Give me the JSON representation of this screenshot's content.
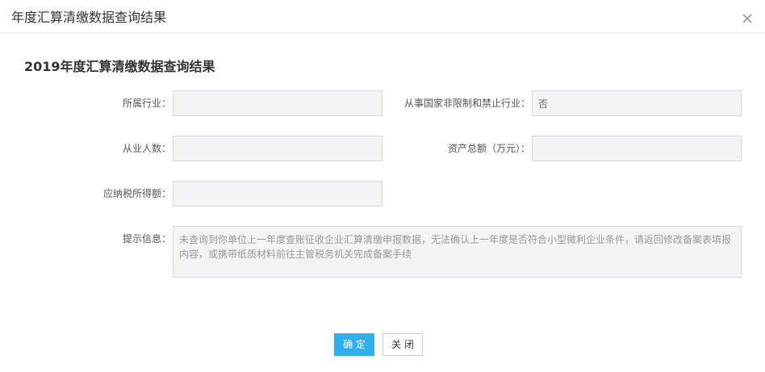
{
  "dialog": {
    "title": "年度汇算清缴数据查询结果",
    "close_icon": "close-icon"
  },
  "content": {
    "heading": "2019年度汇算清缴数据查询结果",
    "fields": {
      "industry": {
        "label": "所属行业："
      },
      "non_restricted": {
        "label": "从事国家非限制和禁止行业：",
        "value": "否"
      },
      "employees": {
        "label": "从业人数："
      },
      "total_assets": {
        "label": "资产总额（万元）："
      },
      "taxable_income": {
        "label": "应纳税所得额："
      },
      "notice": {
        "label": "提示信息：",
        "value": "未查询到你单位上一年度查账征收企业汇算清缴申报数据，无法确认上一年度是否符合小型微利企业条件，请返回修改备案表填报内容，或携带纸质材料前往主管税务机关完成备案手续"
      }
    }
  },
  "buttons": {
    "confirm": "确 定",
    "close": "关 闭"
  },
  "colors": {
    "accent": "#31b1ec",
    "field_background": "#f4f4f6",
    "field_border": "#d6d6d9"
  }
}
